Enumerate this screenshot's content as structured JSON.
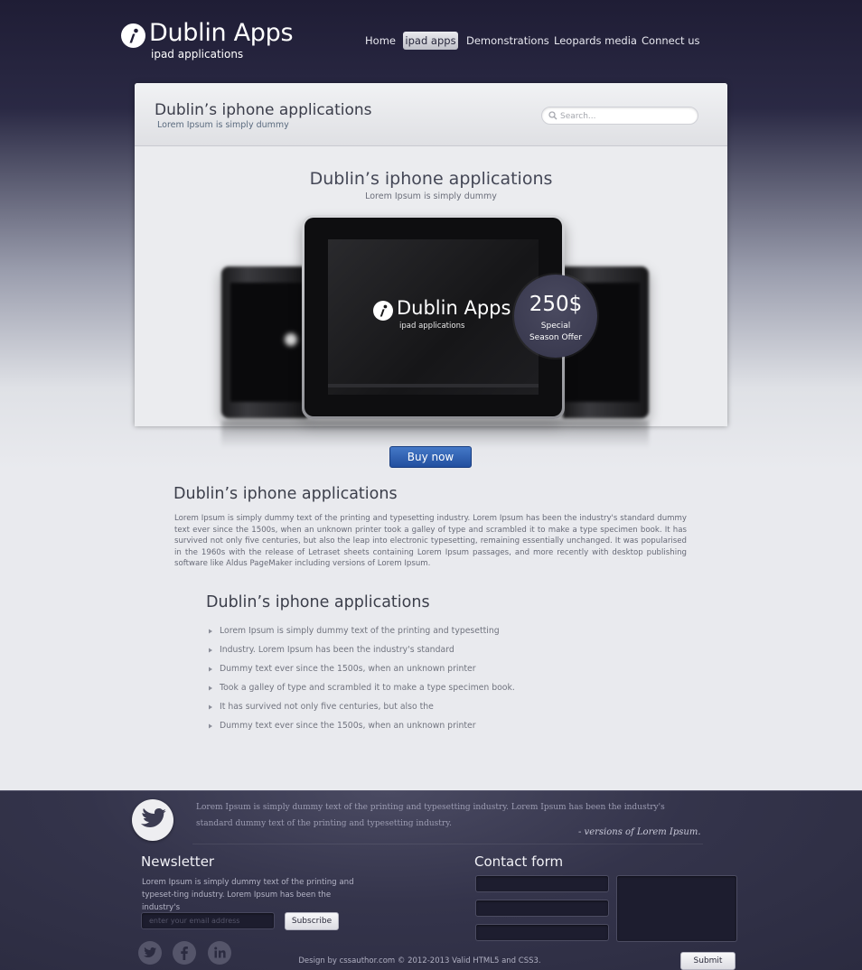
{
  "header": {
    "logo_title": "Dublin Apps",
    "logo_subtitle": "ipad applications",
    "nav": [
      {
        "label": "Home"
      },
      {
        "label": "ipad apps",
        "active": true
      },
      {
        "label": "Demonstrations"
      },
      {
        "label": "Leopards media"
      },
      {
        "label": "Connect us"
      }
    ]
  },
  "panel": {
    "title": "Dublin’s iphone applications",
    "subtitle": "Lorem Ipsum is simply dummy",
    "search_placeholder": "Search..."
  },
  "hero": {
    "title": "Dublin’s iphone applications",
    "subtitle": "Lorem Ipsum is simply dummy",
    "screen_title": "Dublin Apps",
    "screen_subtitle": "ipad applications",
    "price": "250$",
    "offer": "Special Season Offer",
    "buy_label": "Buy now"
  },
  "content": {
    "title": "Dublin’s iphone applications",
    "paragraph": "Lorem Ipsum is simply dummy text of the printing and typesetting industry. Lorem Ipsum has been the industry's standard dummy text ever since the 1500s, when an unknown printer took a galley of type and scrambled it to make a type specimen book. It has survived not only five centuries, but also the leap into electronic typesetting, remaining essentially unchanged. It was popularised in the 1960s with the release of Letraset sheets containing Lorem Ipsum passages, and more recently with desktop publishing software like Aldus PageMaker including versions of Lorem Ipsum.",
    "list_title": "Dublin’s iphone applications",
    "list": [
      "Lorem Ipsum is simply dummy text of the printing and typesetting",
      "Industry. Lorem Ipsum has been the industry's standard",
      "Dummy text ever since the 1500s, when an unknown printer",
      "Took a galley of type and scrambled it to make a type specimen book.",
      "It has survived not only five centuries, but also the",
      "Dummy text ever since the 1500s, when an unknown printer"
    ]
  },
  "footer": {
    "quote": "Lorem Ipsum is simply dummy text of the printing and typesetting industry. Lorem Ipsum has been the industry's standard dummy text  of the printing and typesetting industry.",
    "quote_author": "- versions of Lorem Ipsum.",
    "newsletter_title": "Newsletter",
    "newsletter_text": "Lorem Ipsum is simply dummy text of the printing and typeset-ting industry. Lorem Ipsum has been the industry's",
    "email_placeholder": "enter your email address",
    "subscribe_label": "Subscribe",
    "contact_title": "Contact form",
    "submit_label": "Submit",
    "credit": "Design by cssauthor.com © 2012-2013  Valid HTML5 and CSS3.",
    "social_icons": [
      "twitter-icon",
      "facebook-icon",
      "linkedin-icon"
    ]
  },
  "colors": {
    "header_bg": "#1f1d35",
    "accent_button": "#2f5fb1",
    "footer_bg": "#34344b",
    "panel_bg": "#ebecef"
  }
}
